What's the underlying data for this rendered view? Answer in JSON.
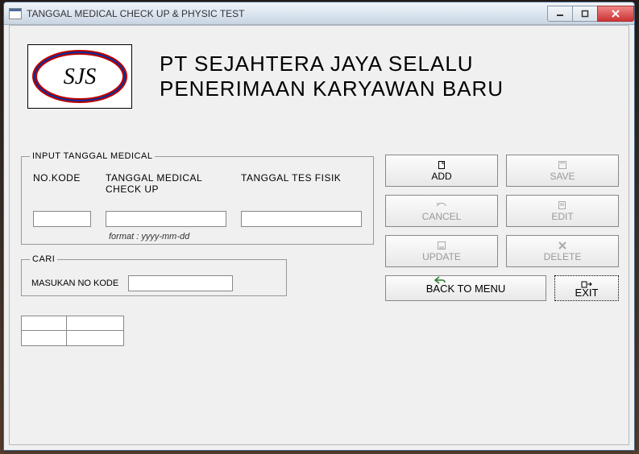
{
  "window": {
    "title": "TANGGAL MEDICAL CHECK UP & PHYSIC TEST"
  },
  "header": {
    "logo_text": "SJS",
    "line1": "PT SEJAHTERA JAYA SELALU",
    "line2": "PENERIMAAN KARYAWAN BARU"
  },
  "group_input": {
    "legend": "INPUT TANGGAL MEDICAL",
    "col_kode": "NO.KODE",
    "col_medical": "TANGGAL MEDICAL CHECK UP",
    "col_fisik": "TANGGAL TES FISIK",
    "val_kode": "",
    "val_medical": "",
    "val_fisik": "",
    "hint": "format : yyyy-mm-dd"
  },
  "group_cari": {
    "legend": "CARI",
    "label": "MASUKAN NO KODE",
    "value": ""
  },
  "buttons": {
    "add": "ADD",
    "save": "SAVE",
    "cancel": "CANCEL",
    "edit": "EDIT",
    "update": "UPDATE",
    "delete": "DELETE",
    "back": "BACK TO MENU",
    "exit": "EXIT"
  }
}
